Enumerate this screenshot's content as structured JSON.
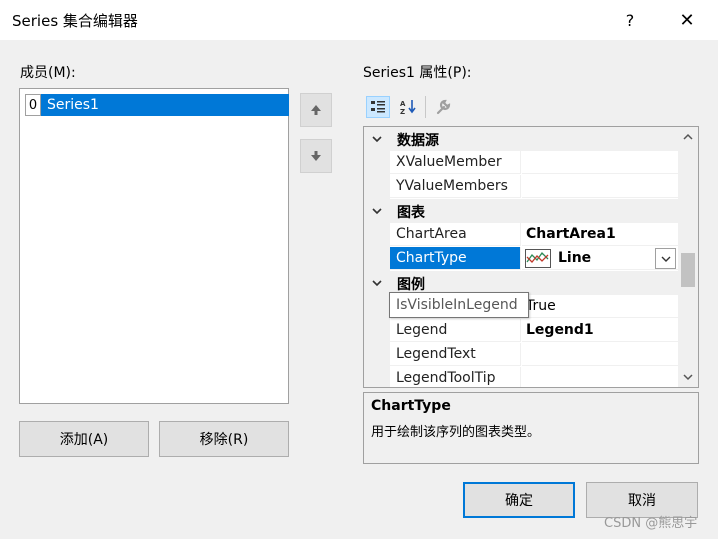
{
  "window": {
    "title": "Series 集合编辑器",
    "help_label": "?",
    "close_label": "✕"
  },
  "members": {
    "label": "成员(M):",
    "items": [
      {
        "index": "0",
        "name": "Series1",
        "selected": true
      }
    ],
    "move_up_icon": "arrow-up-icon",
    "move_down_icon": "arrow-down-icon",
    "add_label": "添加(A)",
    "remove_label": "移除(R)"
  },
  "properties": {
    "label": "Series1 属性(P):",
    "toolbar": {
      "categorized_icon": "categorized-icon",
      "alphabetical_icon": "alphabetical-icon",
      "property_pages_icon": "wrench-icon"
    },
    "rows": {
      "cat_data_source": "数据源",
      "x_value_member": "XValueMember",
      "y_value_members": "YValueMembers",
      "cat_chart": "图表",
      "chart_area": "ChartArea",
      "chart_area_value": "ChartArea1",
      "chart_type": "ChartType",
      "chart_type_value": "Line",
      "cat_legend": "图例",
      "is_visible_value": "True",
      "legend": "Legend",
      "legend_value": "Legend1",
      "legend_text": "LegendText",
      "legend_tooltip": "LegendToolTip"
    },
    "tooltip": "IsVisibleInLegend",
    "description": {
      "title": "ChartType",
      "text": "用于绘制该序列的图表类型。"
    }
  },
  "buttons": {
    "ok": "确定",
    "cancel": "取消"
  },
  "watermark": "CSDN @熊思宇",
  "colors": {
    "selection": "#0078d7",
    "window_bg": "#f0f0f0"
  }
}
